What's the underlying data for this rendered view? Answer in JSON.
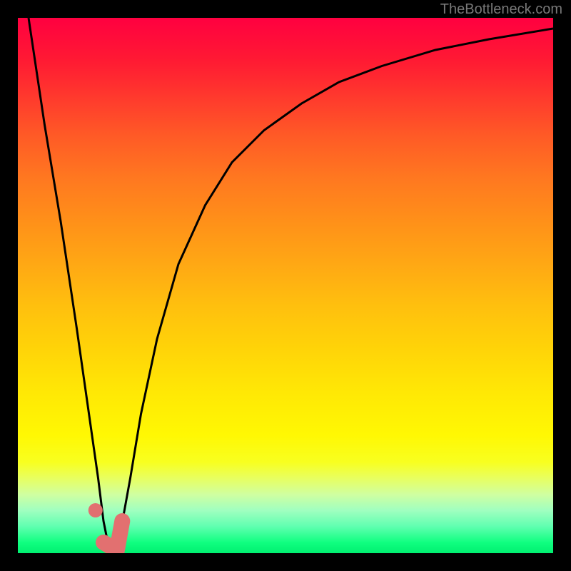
{
  "watermark": "TheBottleneck.com",
  "chart_data": {
    "type": "line",
    "title": "",
    "xlabel": "",
    "ylabel": "",
    "xlim": [
      0,
      100
    ],
    "ylim": [
      0,
      100
    ],
    "grid": false,
    "background_gradient": {
      "top": "#ff0040",
      "mid_high": "#ff7820",
      "mid": "#ffd408",
      "mid_low": "#fff803",
      "bottom": "#00f070"
    },
    "series": [
      {
        "name": "bottleneck-curve",
        "color": "#000000",
        "stroke_width": 3,
        "x": [
          2,
          5,
          8,
          11,
          13,
          15,
          16,
          17,
          18,
          19,
          21,
          23,
          26,
          30,
          35,
          40,
          46,
          53,
          60,
          68,
          78,
          88,
          100
        ],
        "y": [
          100,
          80,
          62,
          42,
          28,
          14,
          6,
          1,
          0,
          3,
          14,
          26,
          40,
          54,
          65,
          73,
          79,
          84,
          88,
          91,
          94,
          96,
          98
        ]
      }
    ],
    "markers": [
      {
        "name": "marker-dot",
        "color": "#e27070",
        "shape": "circle",
        "x": 14.5,
        "y": 8,
        "radius": 10
      },
      {
        "name": "marker-j",
        "color": "#e27070",
        "shape": "j-stroke",
        "stroke_width": 22,
        "points": [
          {
            "x": 16,
            "y": 2
          },
          {
            "x": 18.5,
            "y": 0.5
          },
          {
            "x": 19.5,
            "y": 6
          }
        ]
      }
    ]
  }
}
